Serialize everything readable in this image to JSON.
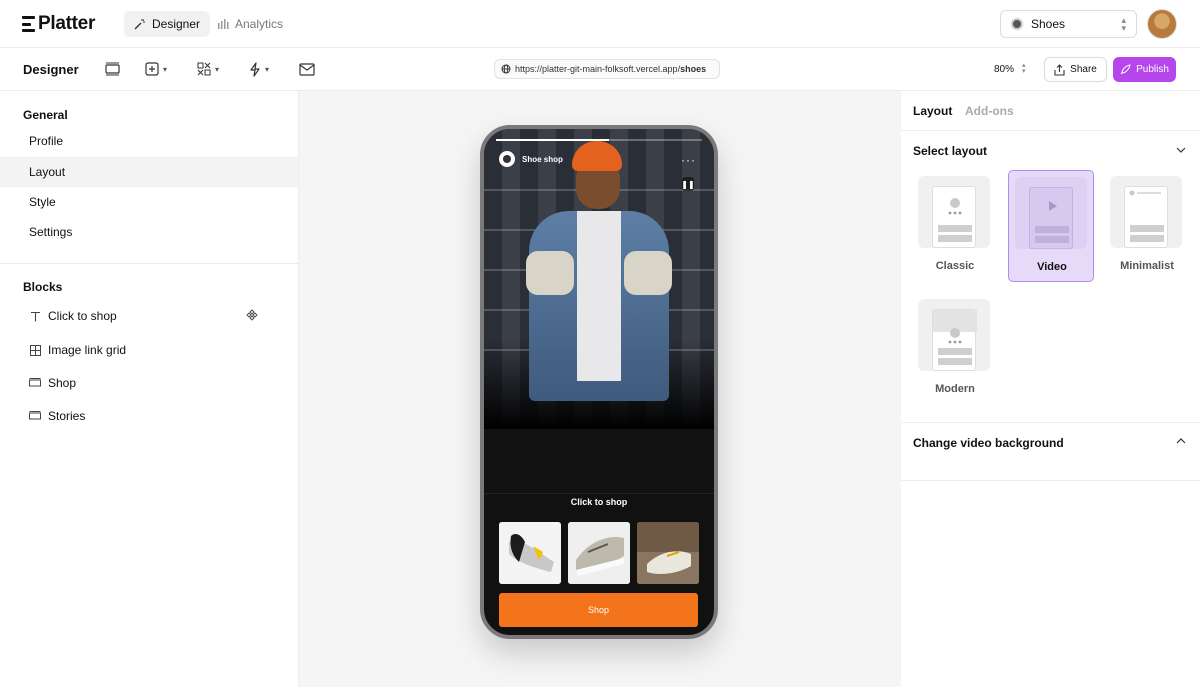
{
  "app": {
    "logo": "Platter",
    "nav": [
      {
        "label": "Designer",
        "icon": "magic-wand-icon",
        "active": true
      },
      {
        "label": "Analytics",
        "icon": "bar-chart-icon",
        "active": false
      }
    ],
    "store_select": "Shoes"
  },
  "toolbar": {
    "title": "Designer",
    "url_base": "https://platter-git-main-folksoft.vercel.app/",
    "url_path": "shoes",
    "zoom": "80%",
    "share_label": "Share",
    "publish_label": "Publish"
  },
  "sidebar": {
    "general_title": "General",
    "general_items": [
      {
        "label": "Profile",
        "active": false
      },
      {
        "label": "Layout",
        "active": true
      },
      {
        "label": "Style",
        "active": false
      },
      {
        "label": "Settings",
        "active": false
      }
    ],
    "blocks_title": "Blocks",
    "blocks": [
      {
        "label": "Click to shop",
        "icon": "text-icon"
      },
      {
        "label": "Image link grid",
        "icon": "grid-icon"
      },
      {
        "label": "Shop",
        "icon": "card-icon"
      },
      {
        "label": "Stories",
        "icon": "card-icon"
      }
    ]
  },
  "phone": {
    "shop_name": "Shoe shop",
    "click_to_shop": "Click to shop",
    "shop_button": "Shop"
  },
  "right_panel": {
    "tabs": [
      {
        "label": "Layout",
        "active": true
      },
      {
        "label": "Add-ons",
        "active": false
      }
    ],
    "select_layout_title": "Select layout",
    "layouts": [
      {
        "label": "Classic",
        "selected": false
      },
      {
        "label": "Video",
        "selected": true
      },
      {
        "label": "Minimalist",
        "selected": false
      },
      {
        "label": "Modern",
        "selected": false
      }
    ],
    "video_bg_title": "Change video background"
  },
  "colors": {
    "accent": "#b546ec",
    "shop_button": "#f4741b",
    "selected_card": "#e6daf9"
  }
}
